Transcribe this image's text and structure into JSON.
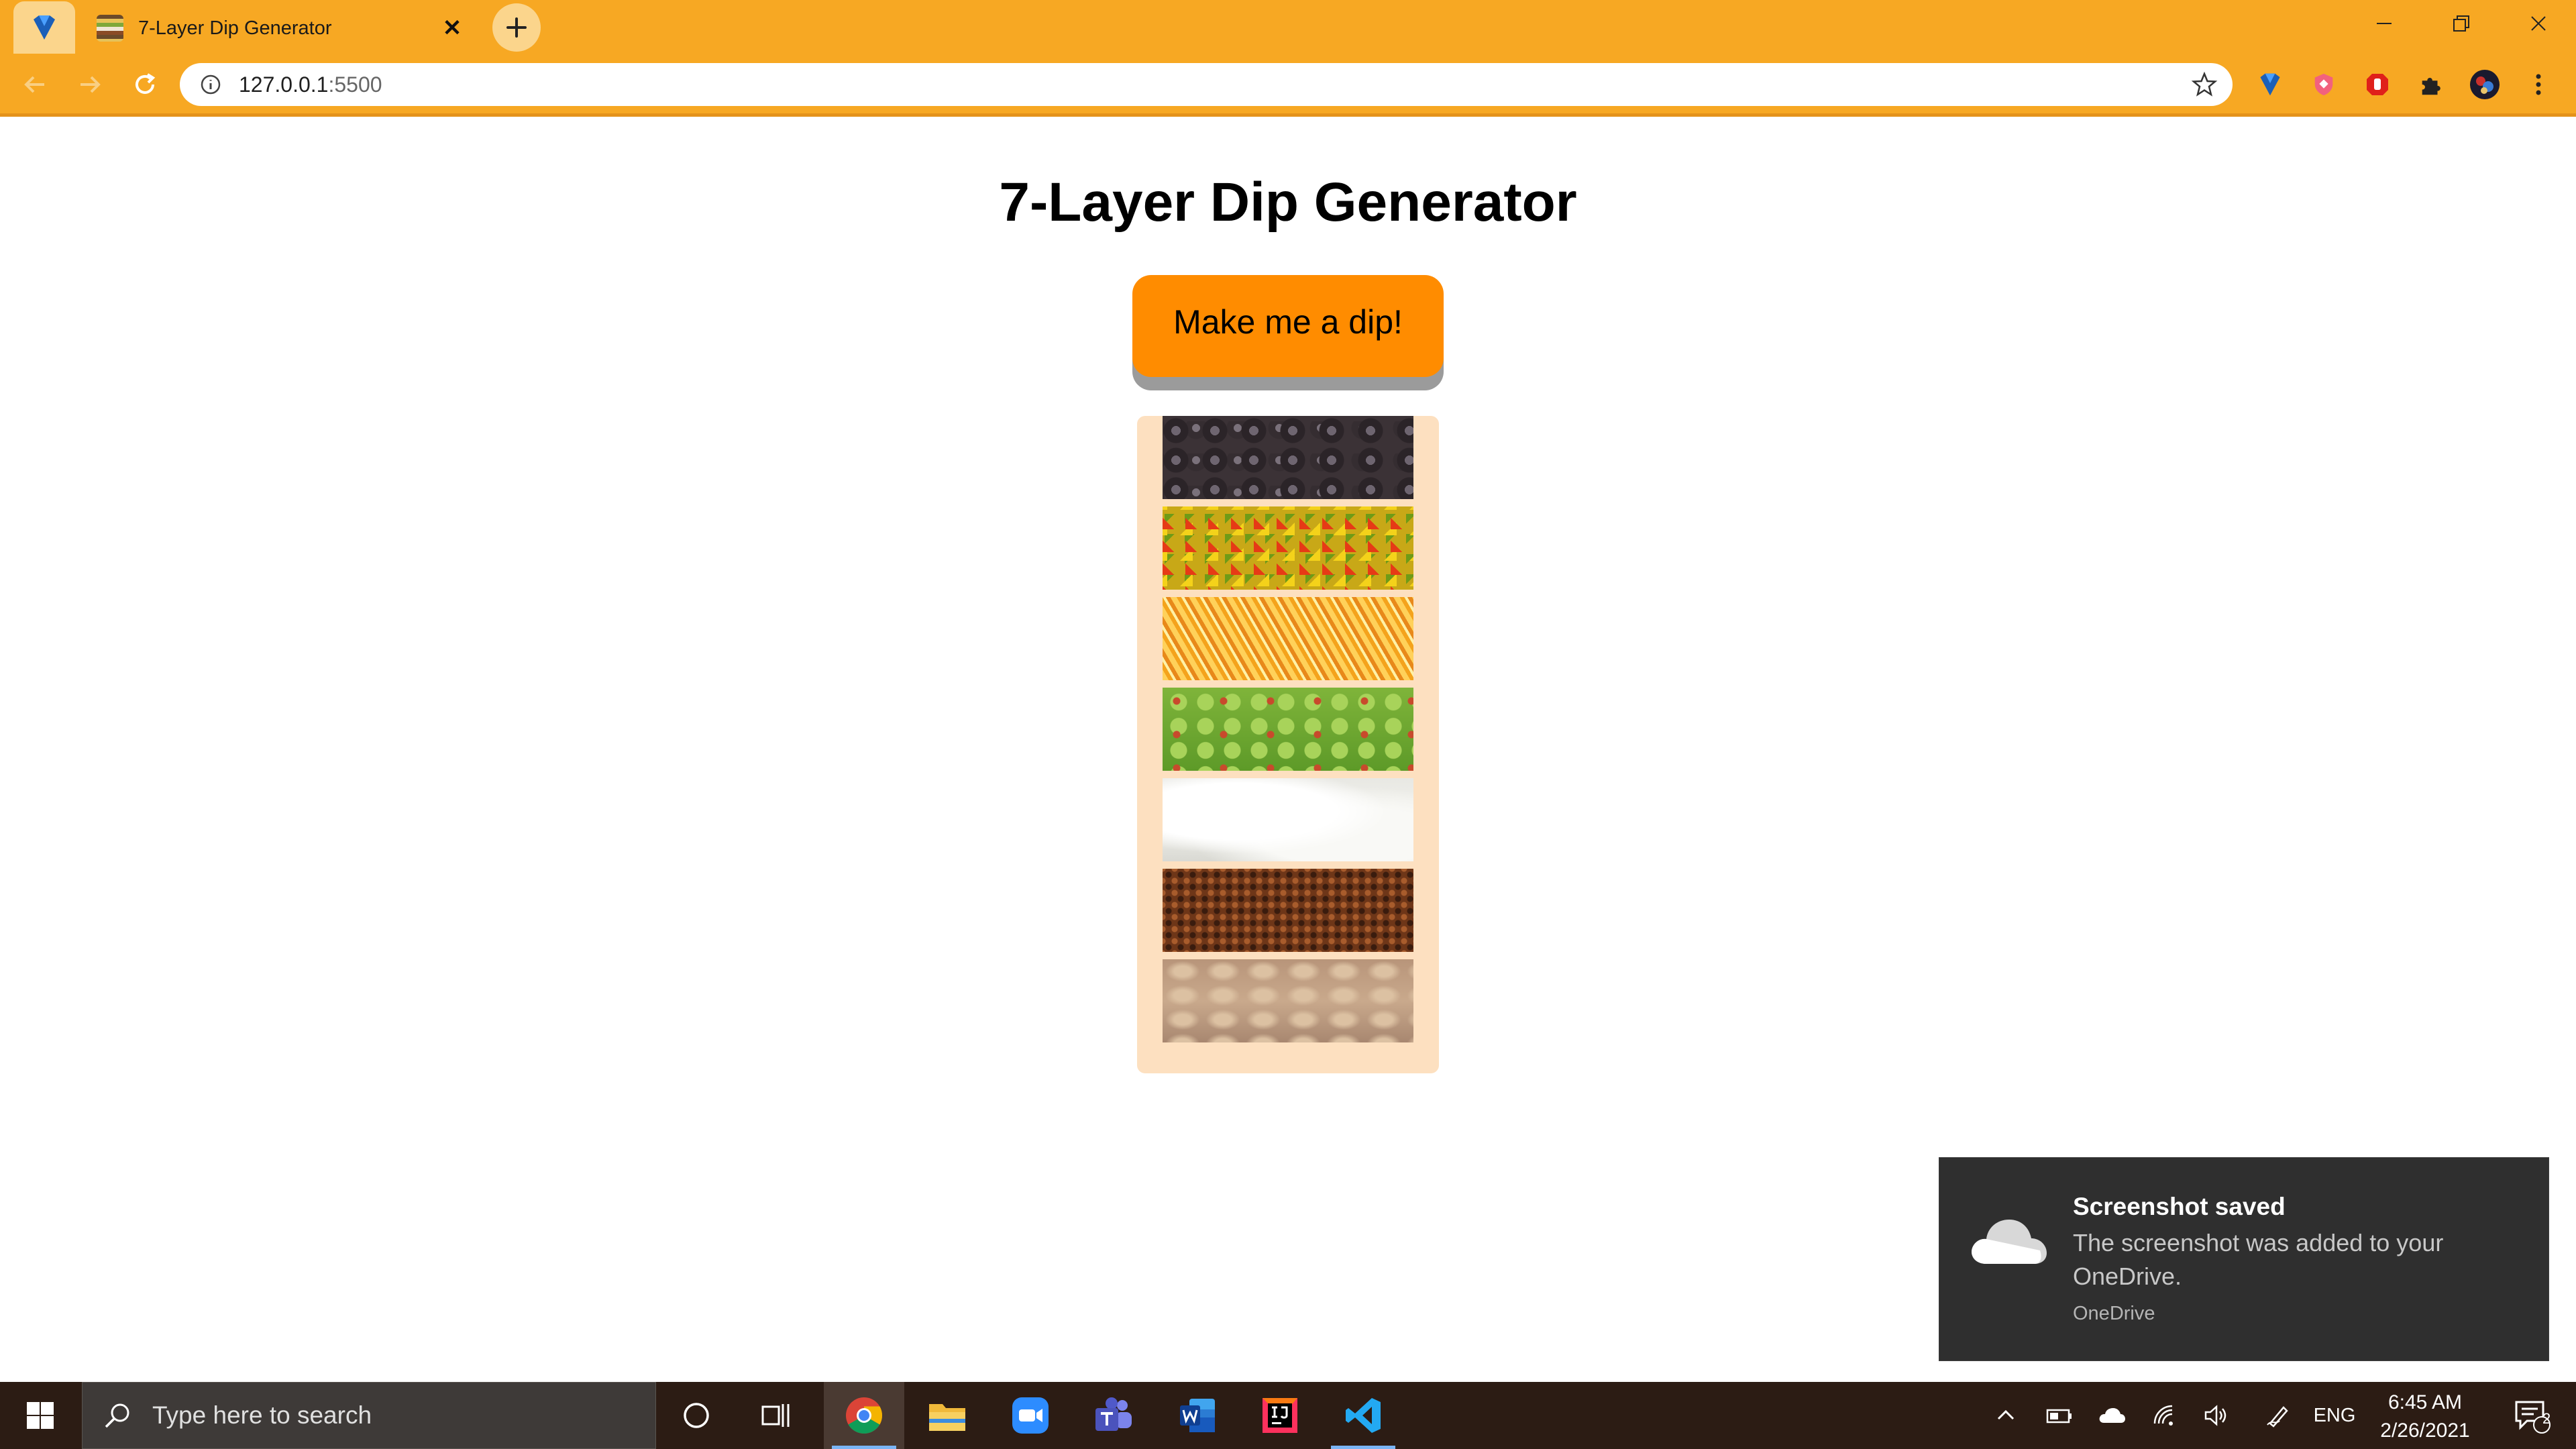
{
  "browser": {
    "tab_title": "7-Layer Dip Generator",
    "tab_close": "✕",
    "address": "127.0.0.1",
    "port": ":5500"
  },
  "page": {
    "title": "7-Layer Dip Generator",
    "button_label": "Make me a dip!",
    "layers": [
      {
        "name": "black-olives"
      },
      {
        "name": "diced-peppers"
      },
      {
        "name": "shredded-cheese"
      },
      {
        "name": "guacamole"
      },
      {
        "name": "sour-cream"
      },
      {
        "name": "ground-beef"
      },
      {
        "name": "refried-beans"
      }
    ],
    "colors": {
      "accent": "#ff8c00",
      "container": "#fde0c0",
      "chrome": "#f7a823"
    }
  },
  "toast": {
    "title": "Screenshot saved",
    "message": "The screenshot was added to your OneDrive.",
    "source": "OneDrive"
  },
  "taskbar": {
    "search_placeholder": "Type here to search",
    "language": "ENG",
    "time": "6:45 AM",
    "date": "2/26/2021",
    "notification_count": "2"
  }
}
